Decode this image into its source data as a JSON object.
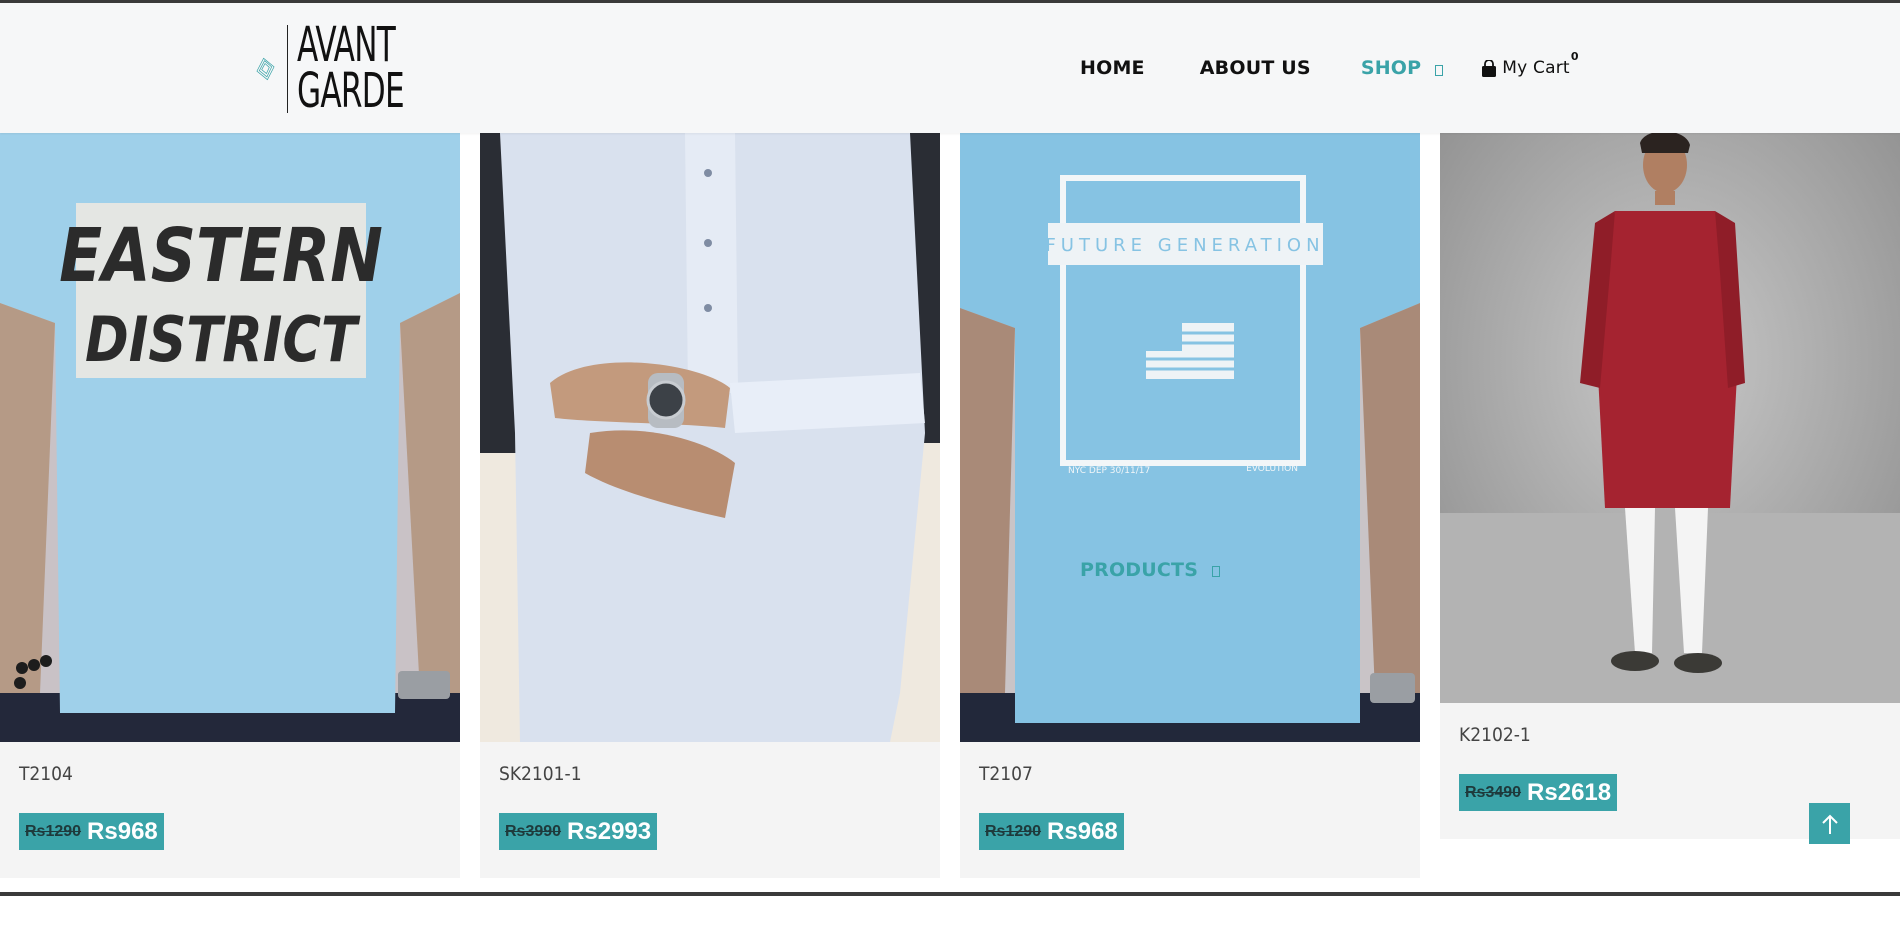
{
  "brand": {
    "line1": "AVANT",
    "line2": "GARDE"
  },
  "nav": {
    "items": [
      {
        "label": "HOME"
      },
      {
        "label": "PRODUCTS"
      },
      {
        "label": "ABOUT US"
      },
      {
        "label": "SHOP"
      }
    ],
    "cart_label": "My Cart",
    "cart_count": "0"
  },
  "products": [
    {
      "name": "T2104",
      "old_price": "Rs1290",
      "new_price": "Rs968",
      "image": {
        "kind": "tshirt",
        "print_line1": "EASTERN",
        "print_line2": "DISTRICT"
      }
    },
    {
      "name": "SK2101-1",
      "old_price": "Rs3990",
      "new_price": "Rs2993",
      "image": {
        "kind": "shalwar-kameez"
      }
    },
    {
      "name": "T2107",
      "old_price": "Rs1290",
      "new_price": "Rs968",
      "image": {
        "kind": "tshirt",
        "print_line1": "FUTURE GENERATION",
        "print_caption_left": "NYC DEP 30/11/17",
        "print_caption_right": "EVOLUTION"
      }
    },
    {
      "name": "K2102-1",
      "old_price": "Rs3490",
      "new_price": "Rs2618",
      "image": {
        "kind": "kurta"
      }
    }
  ],
  "colors": {
    "accent": "#3aa3a8",
    "shirt_blue": "#9fd0ea",
    "card_bg": "#f4f4f4",
    "kurta_red": "#a52330"
  },
  "icons": {
    "cart": "shopping-bag-icon",
    "dropdown": "caret-box-icon",
    "back_to_top": "arrow-up-icon"
  }
}
